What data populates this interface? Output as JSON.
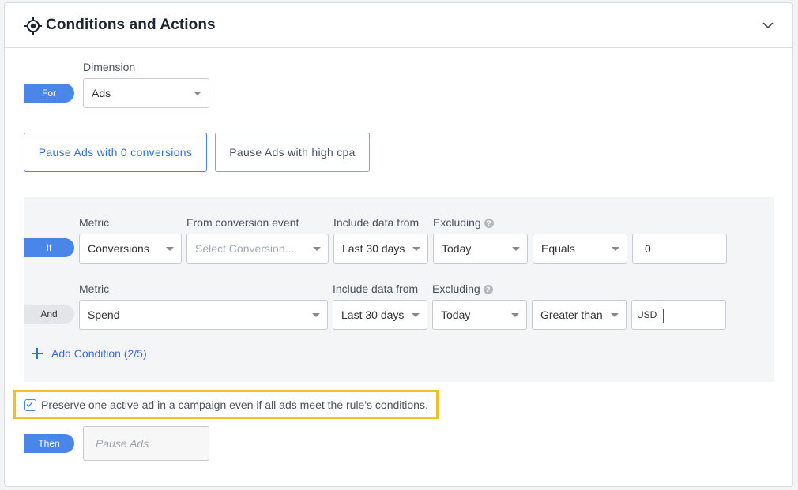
{
  "header": {
    "title": "Conditions and Actions",
    "icon": "target-icon"
  },
  "for_row": {
    "pill": "For",
    "dimension_label": "Dimension",
    "dimension_value": "Ads"
  },
  "templates": [
    {
      "label": "Pause Ads with 0 conversions",
      "active": true
    },
    {
      "label": "Pause Ads with high cpa",
      "active": false
    }
  ],
  "if_row": {
    "pill": "If",
    "metric_label": "Metric",
    "metric_value": "Conversions",
    "conv_label": "From conversion event",
    "conv_placeholder": "Select Conversion...",
    "data_label": "Include data from",
    "data_value": "Last 30 days",
    "excl_label": "Excluding",
    "excl_value": "Today",
    "operator": "Equals",
    "value": "0"
  },
  "and_row": {
    "pill": "And",
    "metric_label": "Metric",
    "metric_value": "Spend",
    "data_label": "Include data from",
    "data_value": "Last 30 days",
    "excl_label": "Excluding",
    "excl_value": "Today",
    "operator": "Greater than",
    "currency": "USD",
    "value": ""
  },
  "add_condition": "Add Condition (2/5)",
  "preserve": {
    "checked": true,
    "label": "Preserve one active ad in a campaign even if all ads meet the rule's conditions."
  },
  "then_row": {
    "pill": "Then",
    "placeholder": "Pause Ads"
  },
  "colors": {
    "accent": "#4a86e8",
    "highlight": "#f2be2c"
  }
}
